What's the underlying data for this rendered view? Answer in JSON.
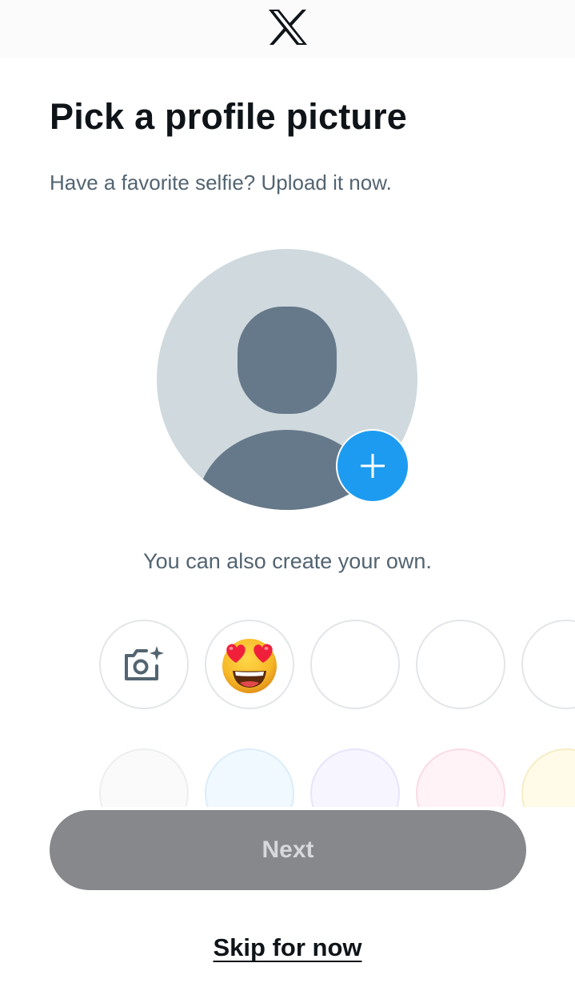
{
  "header": {
    "logo": "x-logo-icon"
  },
  "main": {
    "title": "Pick a profile picture",
    "subtitle": "Have a favorite selfie? Upload it now.",
    "avatar": {
      "icon": "default-avatar-icon",
      "add_icon": "plus-icon"
    },
    "create_text": "You can also create your own."
  },
  "options_row1": [
    {
      "icon": "camera-sparkle-icon"
    },
    {
      "icon": "heart-eyes-emoji-icon"
    },
    {
      "icon": ""
    },
    {
      "icon": ""
    },
    {
      "icon": ""
    }
  ],
  "options_row2_colors": [
    "#fafafa",
    "#f0f9ff",
    "#f7f5ff",
    "#fff3f7",
    "#fffbe8"
  ],
  "footer": {
    "next_label": "Next",
    "skip_label": "Skip for now"
  },
  "colors": {
    "accent": "#1d9bf0",
    "avatar_bg": "#cfd9de",
    "avatar_fg": "#66798a",
    "disabled_button": "#86888c"
  }
}
